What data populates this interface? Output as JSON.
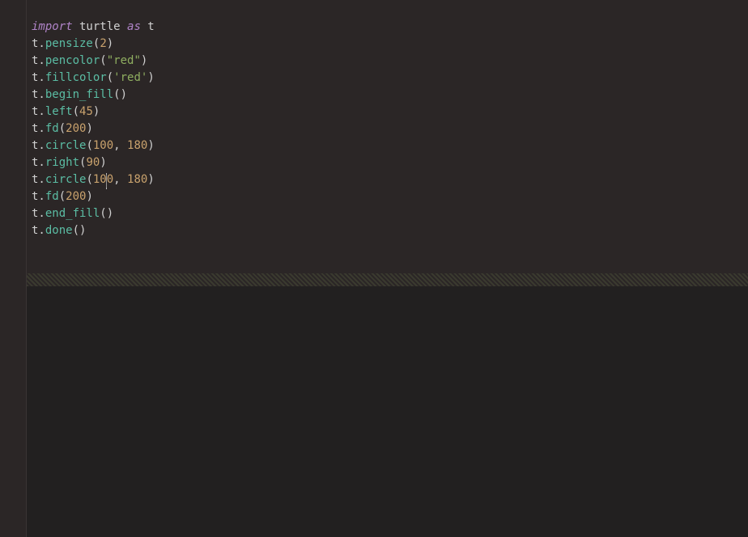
{
  "colors": {
    "background": "#2b2626",
    "keyword": "#b084c8",
    "function": "#5bbda4",
    "number": "#c9a26d",
    "string": "#8fae60",
    "plain": "#d0d0d0"
  },
  "cursor": {
    "line": 10,
    "col": 11
  },
  "code": {
    "lines": [
      [
        {
          "t": "kw",
          "v": "import"
        },
        {
          "t": "plain",
          "v": " turtle "
        },
        {
          "t": "kw",
          "v": "as"
        },
        {
          "t": "plain",
          "v": " t"
        }
      ],
      [
        {
          "t": "plain",
          "v": "t."
        },
        {
          "t": "func",
          "v": "pensize"
        },
        {
          "t": "punct",
          "v": "("
        },
        {
          "t": "num",
          "v": "2"
        },
        {
          "t": "punct",
          "v": ")"
        }
      ],
      [
        {
          "t": "plain",
          "v": "t."
        },
        {
          "t": "func",
          "v": "pencolor"
        },
        {
          "t": "punct",
          "v": "("
        },
        {
          "t": "str",
          "v": "\"red\""
        },
        {
          "t": "punct",
          "v": ")"
        }
      ],
      [
        {
          "t": "plain",
          "v": "t."
        },
        {
          "t": "func",
          "v": "fillcolor"
        },
        {
          "t": "punct",
          "v": "("
        },
        {
          "t": "str",
          "v": "'red'"
        },
        {
          "t": "punct",
          "v": ")"
        }
      ],
      [
        {
          "t": "plain",
          "v": "t."
        },
        {
          "t": "func",
          "v": "begin_fill"
        },
        {
          "t": "punct",
          "v": "()"
        }
      ],
      [
        {
          "t": "plain",
          "v": "t."
        },
        {
          "t": "func",
          "v": "left"
        },
        {
          "t": "punct",
          "v": "("
        },
        {
          "t": "num",
          "v": "45"
        },
        {
          "t": "punct",
          "v": ")"
        }
      ],
      [
        {
          "t": "plain",
          "v": "t."
        },
        {
          "t": "func",
          "v": "fd"
        },
        {
          "t": "punct",
          "v": "("
        },
        {
          "t": "num",
          "v": "200"
        },
        {
          "t": "punct",
          "v": ")"
        }
      ],
      [
        {
          "t": "plain",
          "v": "t."
        },
        {
          "t": "func",
          "v": "circle"
        },
        {
          "t": "punct",
          "v": "("
        },
        {
          "t": "num",
          "v": "100"
        },
        {
          "t": "punct",
          "v": ", "
        },
        {
          "t": "num",
          "v": "180"
        },
        {
          "t": "punct",
          "v": ")"
        }
      ],
      [
        {
          "t": "plain",
          "v": "t."
        },
        {
          "t": "func",
          "v": "right"
        },
        {
          "t": "punct",
          "v": "("
        },
        {
          "t": "num",
          "v": "90"
        },
        {
          "t": "punct",
          "v": ")"
        }
      ],
      [
        {
          "t": "plain",
          "v": "t."
        },
        {
          "t": "func",
          "v": "circle"
        },
        {
          "t": "punct",
          "v": "("
        },
        {
          "t": "num",
          "v": "100"
        },
        {
          "t": "punct",
          "v": ", "
        },
        {
          "t": "num",
          "v": "180"
        },
        {
          "t": "punct",
          "v": ")"
        }
      ],
      [
        {
          "t": "plain",
          "v": "t."
        },
        {
          "t": "func",
          "v": "fd"
        },
        {
          "t": "punct",
          "v": "("
        },
        {
          "t": "num",
          "v": "200"
        },
        {
          "t": "punct",
          "v": ")"
        }
      ],
      [
        {
          "t": "plain",
          "v": "t."
        },
        {
          "t": "func",
          "v": "end_fill"
        },
        {
          "t": "punct",
          "v": "()"
        }
      ],
      [
        {
          "t": "plain",
          "v": "t."
        },
        {
          "t": "func",
          "v": "done"
        },
        {
          "t": "punct",
          "v": "()"
        }
      ]
    ]
  }
}
